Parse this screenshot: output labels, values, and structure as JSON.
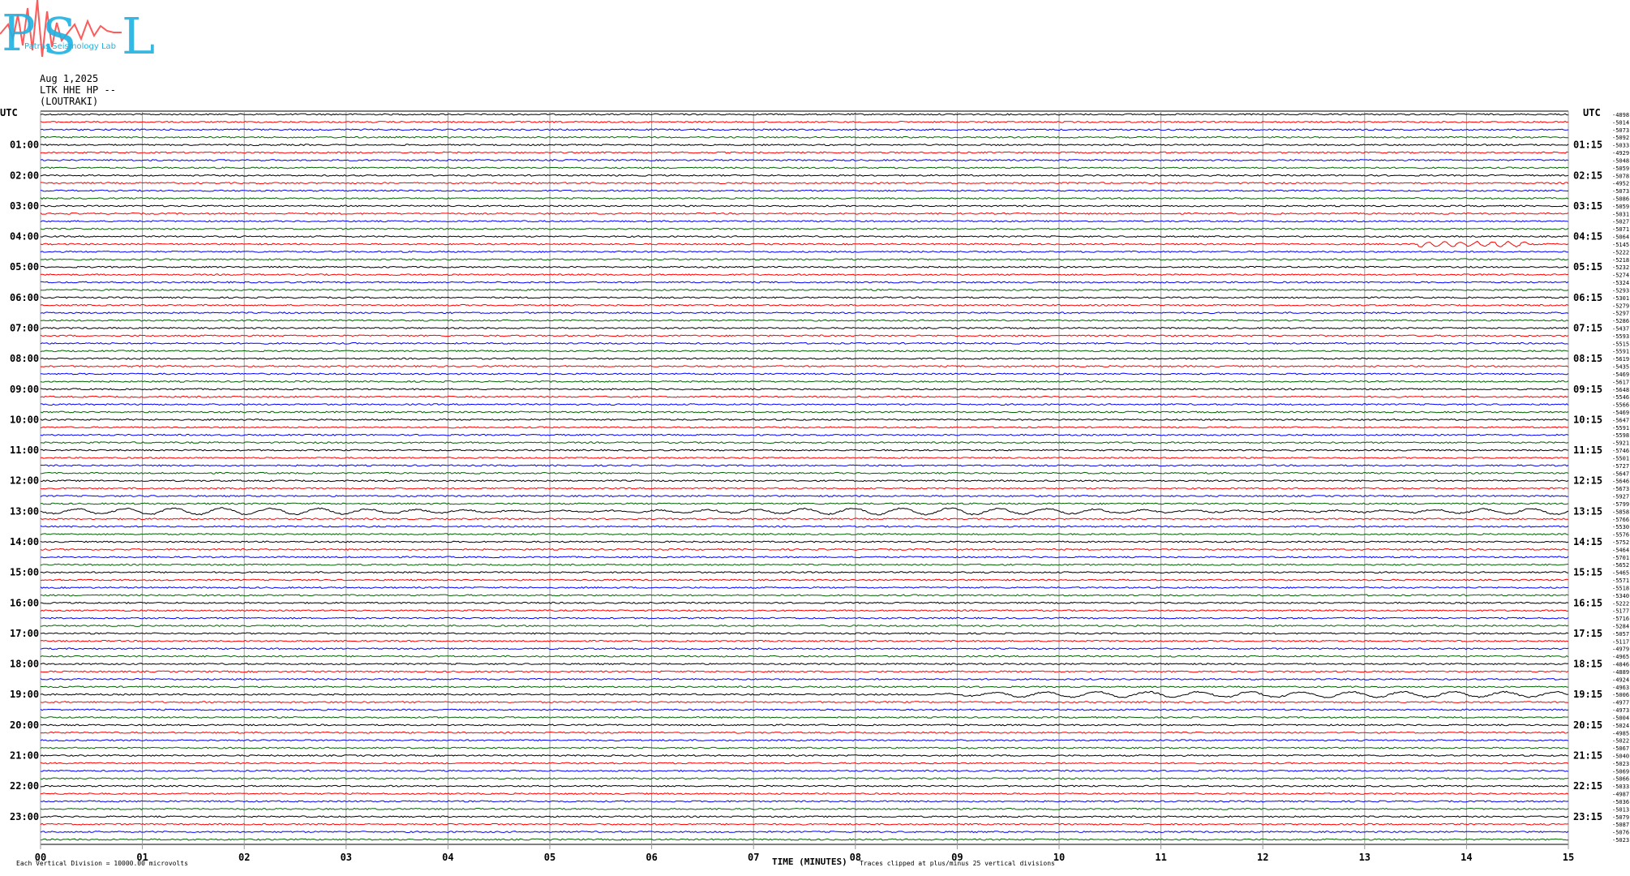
{
  "header": {
    "logo_text": "PSL",
    "logo_subtext": "Patras Seismology Lab",
    "date": "Aug 1,2025",
    "station": "LTK HHE HP --",
    "location": "(LOUTRAKI)"
  },
  "footer": {
    "left_note": "Each Vertical Division = 10000.00 microvolts",
    "xlabel": "TIME (MINUTES)",
    "right_note": "Traces clipped at plus/minus 25 vertical divisions"
  },
  "chart_data": {
    "type": "line",
    "title": "",
    "xlabel": "TIME (MINUTES)",
    "ylabel": "UTC",
    "xlim": [
      0,
      15
    ],
    "x_ticks": [
      "00",
      "01",
      "02",
      "03",
      "04",
      "05",
      "06",
      "07",
      "08",
      "09",
      "10",
      "11",
      "12",
      "13",
      "14",
      "15"
    ],
    "left_axis_label": "UTC",
    "right_axis_label": "UTC",
    "left_ticks": [
      "01:00",
      "02:00",
      "03:00",
      "04:00",
      "05:00",
      "06:00",
      "07:00",
      "08:00",
      "09:00",
      "10:00",
      "11:00",
      "12:00",
      "13:00",
      "14:00",
      "15:00",
      "16:00",
      "17:00",
      "18:00",
      "19:00",
      "20:00",
      "21:00",
      "22:00",
      "23:00"
    ],
    "right_ticks": [
      "01:15",
      "02:15",
      "03:15",
      "04:15",
      "05:15",
      "06:15",
      "07:15",
      "08:15",
      "09:15",
      "10:15",
      "11:15",
      "12:15",
      "13:15",
      "14:15",
      "15:15",
      "16:15",
      "17:15",
      "18:15",
      "19:15",
      "20:15",
      "21:15",
      "22:15",
      "23:15"
    ],
    "trace_colors": [
      "#000000",
      "#ff0000",
      "#0000ff",
      "#006400"
    ],
    "trace_offsets": [
      "-4898",
      "-5014",
      "-5073",
      "-5092",
      "-5033",
      "-4929",
      "-5048",
      "-5059",
      "-5078",
      "-4952",
      "-5073",
      "-5086",
      "-5059",
      "-5031",
      "-5027",
      "-5071",
      "-5064",
      "-5145",
      "-5222",
      "-5218",
      "-5232",
      "-5274",
      "-5324",
      "-5293",
      "-5301",
      "-5279",
      "-5297",
      "-5286",
      "-5437",
      "-5593",
      "-5515",
      "-5591",
      "-5619",
      "-5435",
      "-5469",
      "-5617",
      "-5648",
      "-5546",
      "-5566",
      "-5469",
      "-5647",
      "-5591",
      "-5598",
      "-5921",
      "-5746",
      "-5501",
      "-5727",
      "-5647",
      "-5646",
      "-5673",
      "-5927",
      "-5799",
      "-5858",
      "-5766",
      "-5530",
      "-5576",
      "-5752",
      "-5464",
      "-5701",
      "-5652",
      "-5465",
      "-5571",
      "-5518",
      "-5340",
      "-5222",
      "-5177",
      "-5716",
      "-5284",
      "-5057",
      "-5117",
      "-4979",
      "-4965",
      "-4846",
      "-4889",
      "-4924",
      "-4963",
      "-5006",
      "-4977",
      "-4973",
      "-5004",
      "-5024",
      "-4985",
      "-5022",
      "-5067",
      "-5040",
      "-5023",
      "-5069",
      "-5066",
      "-5033",
      "-4987",
      "-5036",
      "-5013",
      "-5079",
      "-5087",
      "-5076",
      "-5023"
    ],
    "trace_count": 96,
    "minutes_per_trace": 15,
    "vertical_division_microvolts": 10000.0,
    "clip_divisions": 25,
    "notable_events": [
      {
        "trace_time": "13:00",
        "x_start": 0,
        "x_end": 15,
        "note": "long-period wave train"
      },
      {
        "trace_time": "19:00",
        "x_start": 8.5,
        "x_end": 15,
        "note": "long-period wave train"
      }
    ]
  }
}
